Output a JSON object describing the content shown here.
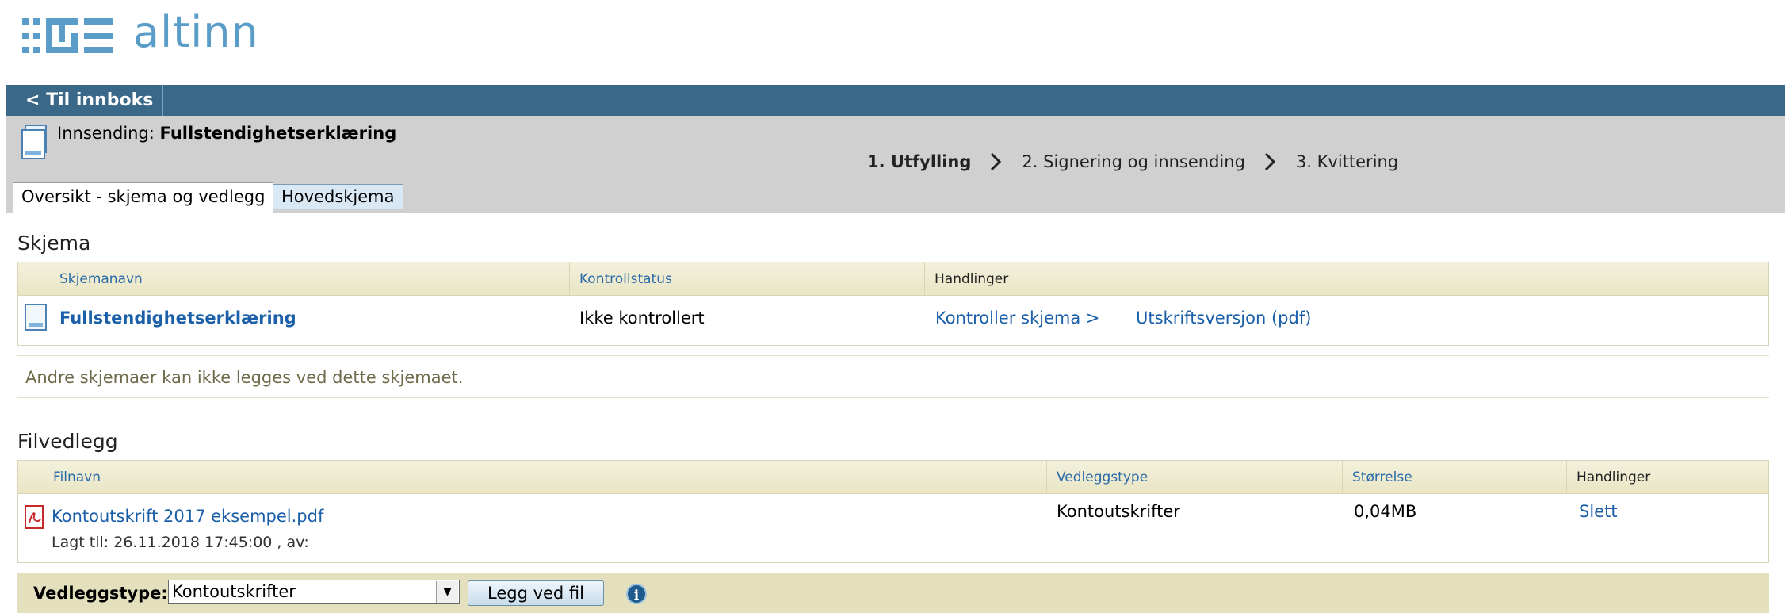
{
  "brand": {
    "logo_text": "altinn",
    "logo_color": "#5b9dc9"
  },
  "nav": {
    "back_label": "< Til innboks"
  },
  "header": {
    "submission_prefix": "Innsending: ",
    "submission_name": "Fullstendighetserklæring",
    "steps": [
      "1. Utfylling",
      "2. Signering og innsending",
      "3. Kvittering"
    ],
    "active_step": 0,
    "tabs": [
      "Oversikt - skjema og vedlegg",
      "Hovedskjema"
    ]
  },
  "forms": {
    "title": "Skjema",
    "columns": [
      "Skjemanavn",
      "Kontrollstatus",
      "Handlinger"
    ],
    "rows": [
      {
        "name": "Fullstendighetserklæring",
        "status": "Ikke kontrollert",
        "action_check": "Kontroller skjema >",
        "action_print": "Utskriftsversjon (pdf)"
      }
    ],
    "note": "Andre skjemaer kan ikke legges ved dette skjemaet."
  },
  "attachments": {
    "title": "Filvedlegg",
    "columns": [
      "Filnavn",
      "Vedleggstype",
      "Størrelse",
      "Handlinger"
    ],
    "rows": [
      {
        "filename": "Kontoutskrift 2017 eksempel.pdf",
        "added": "Lagt til: 26.11.2018 17:45:00 , av:",
        "type": "Kontoutskrifter",
        "size": "0,04MB",
        "action": "Slett"
      }
    ]
  },
  "upload": {
    "label": "Vedleggstype:",
    "selected_type": "Kontoutskrifter",
    "button": "Legg ved fil",
    "info_icon": "i"
  },
  "colors": {
    "nav": "#3a6888",
    "header": "#d0d0d0",
    "table_header": "#ece8cb",
    "link": "#1a5fa8"
  }
}
